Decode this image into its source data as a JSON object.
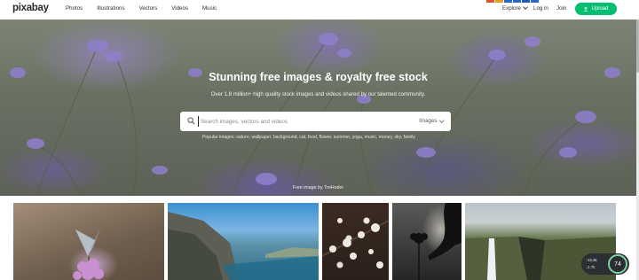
{
  "header": {
    "logo": "pixabay",
    "nav": [
      "Photos",
      "Illustrations",
      "Vectors",
      "Videos",
      "Music"
    ],
    "explore_label": "Explore",
    "login_label": "Log in",
    "join_label": "Join",
    "upload_label": "Upload",
    "accent_color": "#02be6e"
  },
  "hero": {
    "title": "Stunning free images & royalty free stock",
    "subtitle": "Over 1.8 million+ high quality stock images and videos shared by our talented community.",
    "search_placeholder": "Search images, vectors and videos",
    "search_type": "Images",
    "popular": "Popular images: nature, wallpaper, background, cat, food, flower, summer, yoga, music, money, sky, family",
    "credit": "Free image by TreHoder"
  },
  "gallery": {
    "tiles": [
      "butterfly-on-flower",
      "coastal-cliffs",
      "blossom-branch",
      "silhouette-hand-flower",
      "waterfall-valley"
    ]
  },
  "perf": {
    "score": "74",
    "up": "↑15.9k",
    "down": "↓1.7k"
  }
}
